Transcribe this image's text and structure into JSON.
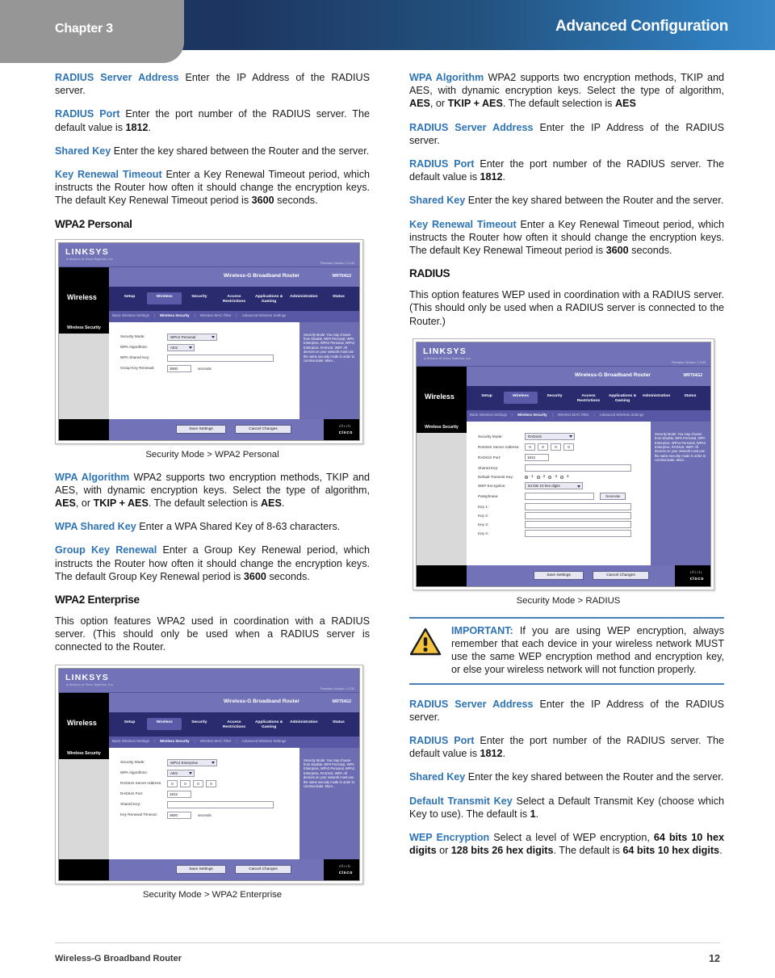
{
  "header": {
    "chapter": "Chapter 3",
    "title": "Advanced Configuration",
    "tab_color": "#969696",
    "bar_gradient_start": "#1d3661",
    "bar_gradient_end": "#3a87c8"
  },
  "accent_color": "#2e74b5",
  "left_column": {
    "p_radius_server_address": {
      "term": "RADIUS Server Address",
      "text": " Enter the IP Address of the RADIUS server."
    },
    "p_radius_port": {
      "term": "RADIUS Port",
      "text_a": "  Enter the port number of the RADIUS server. The default value is ",
      "bold": "1812",
      "text_b": "."
    },
    "p_shared_key": {
      "term": "Shared Key",
      "text": " Enter the key shared between the Router and the server."
    },
    "p_key_renewal_timeout": {
      "term": "Key Renewal Timeout",
      "text_a": " Enter a Key Renewal Timeout period, which instructs the Router how often it should change the encryption keys. The default Key Renewal Timeout period is ",
      "bold": "3600",
      "text_b": " seconds."
    },
    "heading_wpa2_personal": "WPA2 Personal",
    "caption_wpa2_personal": "Security Mode > WPA2 Personal",
    "p_wpa_algorithm": {
      "term": "WPA Algorithm",
      "text_a": " WPA2 supports two encryption methods, TKIP and AES, with dynamic encryption keys. Select the type of algorithm, ",
      "bold_a": "AES",
      "text_b": ", or ",
      "bold_b": "TKIP + AES",
      "text_c": ". The default selection is  ",
      "bold_c": "AES",
      "text_d": "."
    },
    "p_wpa_shared_key": {
      "term": "WPA Shared Key",
      "text": " Enter a WPA Shared Key of 8-63 characters."
    },
    "p_group_key_renewal": {
      "term": "Group Key Renewal",
      "text_a": "  Enter a Group Key Renewal period, which instructs the Router how often it should change the encryption keys. The default Group Key Renewal period is ",
      "bold": "3600",
      "text_b": " seconds."
    },
    "heading_wpa2_enterprise": "WPA2 Enterprise",
    "p_wpa2_enterprise_desc": "This option features WPA2 used in coordination with a RADIUS server. (This should only be used when a RADIUS server is connected to the Router.",
    "caption_wpa2_enterprise": "Security Mode > WPA2 Enterprise"
  },
  "right_column": {
    "p_wpa_algorithm": {
      "term": "WPA Algorithm",
      "text_a": "  WPA2 supports two encryption methods, TKIP and AES, with dynamic encryption keys. Select the type of algorithm, ",
      "bold_a": "AES",
      "text_b": ", or ",
      "bold_b": "TKIP + AES",
      "text_c": ". The default selection is ",
      "bold_c": "AES"
    },
    "p_radius_server_address": {
      "term": "RADIUS Server Address",
      "text": " Enter the IP Address of the RADIUS server."
    },
    "p_radius_port": {
      "term": "RADIUS Port",
      "text_a": "  Enter the port number of the RADIUS server. The default value is ",
      "bold": "1812",
      "text_b": "."
    },
    "p_shared_key": {
      "term": "Shared Key",
      "text": " Enter the key shared between the Router and the server."
    },
    "p_key_renewal_timeout": {
      "term": "Key Renewal Timeout",
      "text_a": " Enter a Key Renewal Timeout period, which instructs the Router how often it should change the encryption keys. The default Key Renewal Timeout period is ",
      "bold": "3600",
      "text_b": " seconds."
    },
    "heading_radius": "RADIUS",
    "p_radius_desc": "This option features WEP used in coordination with a RADIUS server. (This should only be used when a RADIUS server is connected to the Router.)",
    "caption_radius": "Security Mode > RADIUS",
    "callout": {
      "icon": "warning-triangle-icon",
      "lead": "IMPORTANT:",
      "text": " If you are using WEP encryption, always remember that each device in your wireless network MUST use the same WEP encryption method and encryption key, or else your wireless network will not function properly."
    },
    "p_radius_server_address2": {
      "term": "RADIUS Server Address",
      "text": " Enter the IP Address of the RADIUS server."
    },
    "p_radius_port2": {
      "term": "RADIUS Port",
      "text_a": "  Enter the port number of the RADIUS server. The default value is ",
      "bold": "1812",
      "text_b": "."
    },
    "p_shared_key2": {
      "term": "Shared Key",
      "text": " Enter the key shared between the Router and the server."
    },
    "p_default_transmit_key": {
      "term": "Default Transmit Key",
      "text_a": " Select a Default Transmit Key (choose which Key to use). The default is ",
      "bold": "1",
      "text_b": "."
    },
    "p_wep_encryption": {
      "term": "WEP Encryption",
      "text_a": " Select a level of WEP encryption, ",
      "bold_a": "64 bits 10 hex digits",
      "text_b": " or ",
      "bold_b": "128 bits 26 hex digits",
      "text_c": ". The default is ",
      "bold_c": "64 bits 10 hex digits",
      "text_d": "."
    }
  },
  "router_ui": {
    "brand": "LINKSYS",
    "brand_sub": "A Division of Cisco Systems, Inc.",
    "firmware": "Firmware Version: 1.0.00",
    "product_name": "Wireless-G Broadband Router",
    "model_no": "WRT54G2",
    "section_title": "Wireless",
    "sidebar_header": "Wireless Security",
    "tabs": [
      "Setup",
      "Wireless",
      "Security",
      "Access Restrictions",
      "Applications & Gaming",
      "Administration",
      "Status"
    ],
    "active_tab": "Wireless",
    "subnav": [
      "Basic Wireless Settings",
      "Wireless Security",
      "Wireless MAC Filter",
      "Advanced Wireless Settings"
    ],
    "active_subnav": "Wireless Security",
    "save_button": "Save Settings",
    "cancel_button": "Cancel Changes",
    "cisco_wordmark": "cisco",
    "help_text": "Security Mode: You may choose from Disable, WPA Personal, WPA Enterprise, WPA2 Personal, WPA2 Enterprise, RADIUS, WEP. All devices on your network must use the same security mode in order to communicate. More...",
    "screens": {
      "wpa2_personal": {
        "fields": [
          {
            "label": "Security Mode:",
            "type": "select",
            "value": "WPA2 Personal"
          },
          {
            "label": "WPA Algorithms:",
            "type": "select",
            "value": "AES"
          },
          {
            "label": "WPA Shared Key:",
            "type": "text",
            "value": ""
          },
          {
            "label": "Group Key Renewal:",
            "type": "text",
            "value": "3600",
            "unit": "seconds"
          }
        ]
      },
      "wpa2_enterprise": {
        "fields": [
          {
            "label": "Security Mode:",
            "type": "select",
            "value": "WPA2 Enterprise"
          },
          {
            "label": "WPA Algorithms:",
            "type": "select",
            "value": "AES"
          },
          {
            "label": "RADIUS Server Address:",
            "type": "ip",
            "value": [
              "0",
              "0",
              "0",
              "0"
            ]
          },
          {
            "label": "RADIUS Port:",
            "type": "text",
            "value": "1812"
          },
          {
            "label": "Shared Key:",
            "type": "text",
            "value": ""
          },
          {
            "label": "Key Renewal Timeout:",
            "type": "text",
            "value": "3600",
            "unit": "seconds"
          }
        ]
      },
      "radius": {
        "fields": [
          {
            "label": "Security Mode:",
            "type": "select",
            "value": "RADIUS"
          },
          {
            "label": "RADIUS Server Address:",
            "type": "ip",
            "value": [
              "0",
              "0",
              "0",
              "0"
            ]
          },
          {
            "label": "RADIUS Port:",
            "type": "text",
            "value": "1812"
          },
          {
            "label": "Shared Key:",
            "type": "text",
            "value": ""
          },
          {
            "label": "Default Transmit Key:",
            "type": "radio",
            "options": [
              "1",
              "2",
              "3",
              "4"
            ],
            "selected": "1"
          },
          {
            "label": "WEP Encryption:",
            "type": "select",
            "value": "64 bits 10 hex digits"
          },
          {
            "label": "Passphrase:",
            "type": "text",
            "value": "",
            "button": "Generate"
          },
          {
            "label": "Key 1:",
            "type": "text",
            "value": ""
          },
          {
            "label": "Key 2:",
            "type": "text",
            "value": ""
          },
          {
            "label": "Key 3:",
            "type": "text",
            "value": ""
          },
          {
            "label": "Key 4:",
            "type": "text",
            "value": ""
          }
        ]
      }
    }
  },
  "footer": {
    "doc_title": "Wireless-G Broadband Router",
    "page_number": "12"
  }
}
